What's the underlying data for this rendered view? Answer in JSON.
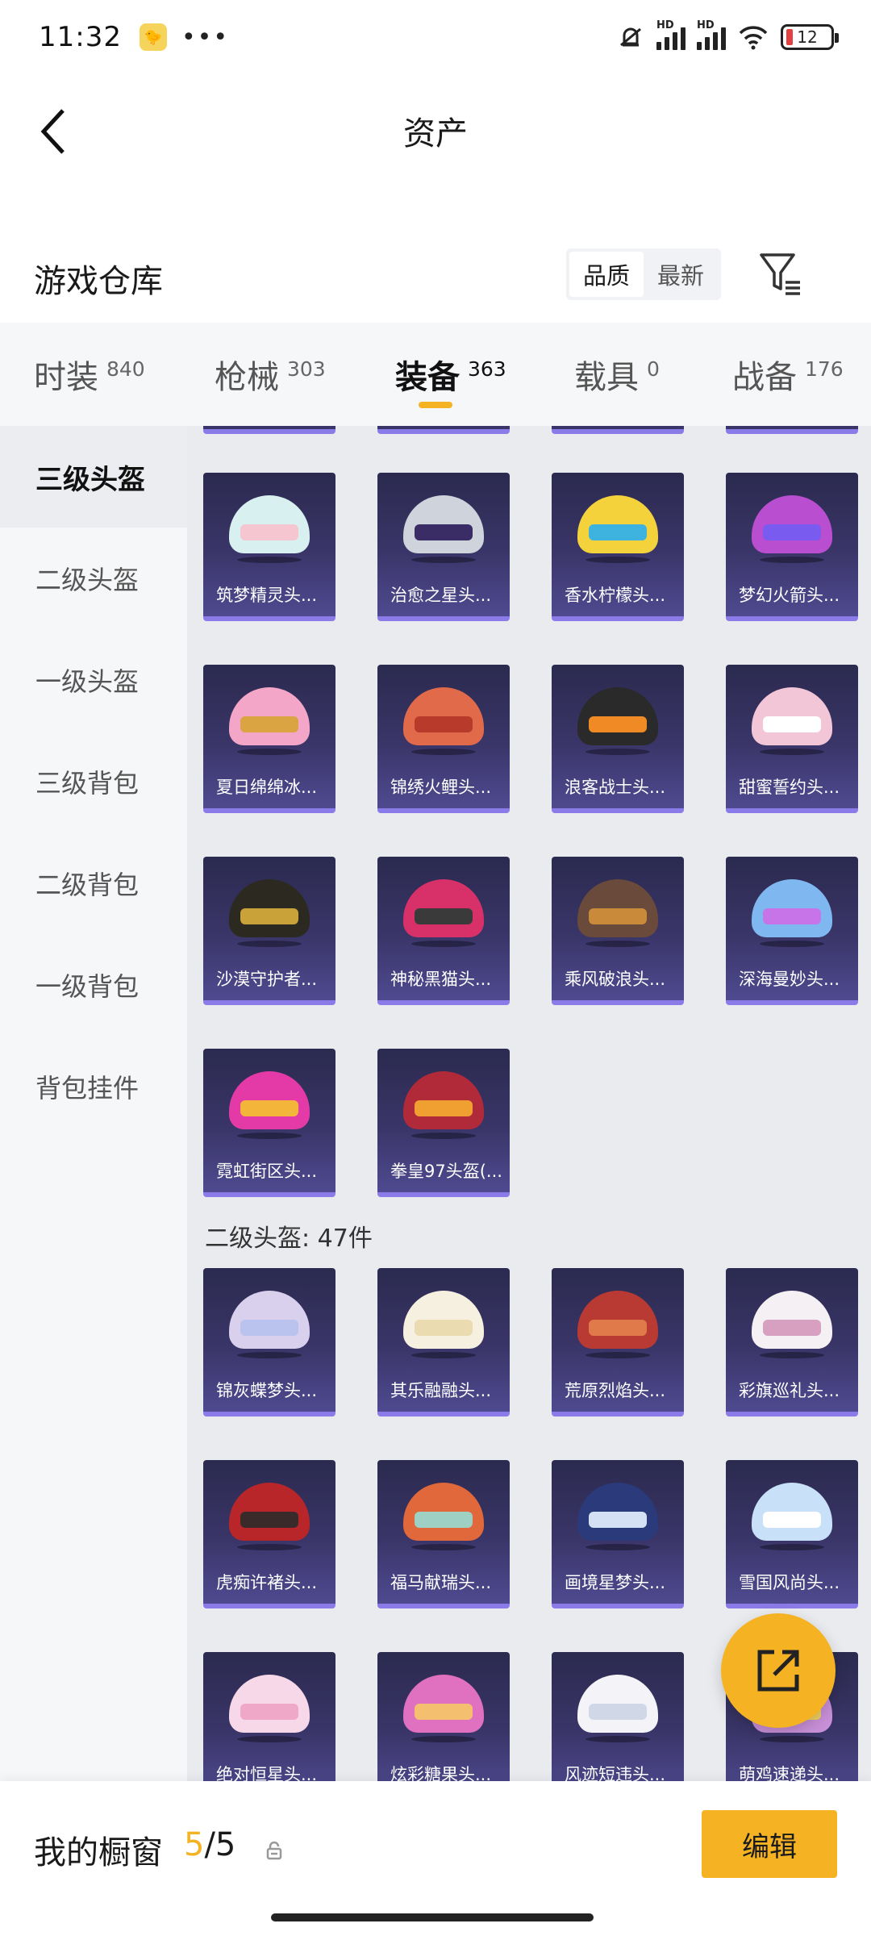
{
  "status_bar": {
    "time": "11:32",
    "dots": "•••",
    "battery": "12",
    "signal_label": "HD",
    "colors": {
      "battery_low": "#e34141"
    }
  },
  "header": {
    "title": "资产",
    "back_icon": "chevron-left-icon"
  },
  "warehouse": {
    "title": "游戏仓库",
    "sort_options": [
      "品质",
      "最新"
    ],
    "sort_selected": "品质",
    "filter_icon": "filter-icon"
  },
  "tabs": [
    {
      "label": "时装",
      "count": "840"
    },
    {
      "label": "枪械",
      "count": "303"
    },
    {
      "label": "装备",
      "count": "363",
      "active": true
    },
    {
      "label": "载具",
      "count": "0"
    },
    {
      "label": "战备",
      "count": "176"
    }
  ],
  "sidebar": {
    "items": [
      "三级头盔",
      "二级头盔",
      "一级头盔",
      "三级背包",
      "二级背包",
      "一级背包",
      "背包挂件"
    ],
    "active_index": 0
  },
  "content": {
    "level3_items": [
      "筑梦精灵头...",
      "治愈之星头...",
      "香水柠檬头...",
      "梦幻火箭头...",
      "夏日绵绵冰...",
      "锦绣火鲤头...",
      "浪客战士头...",
      "甜蜜誓约头...",
      "沙漠守护者...",
      "神秘黑猫头...",
      "乘风破浪头...",
      "深海曼妙头...",
      "霓虹街区头...",
      "拳皇97头盔(..."
    ],
    "level2_header": "二级头盔: 47件",
    "level2_items": [
      "锦灰蝶梦头...",
      "其乐融融头...",
      "荒原烈焰头...",
      "彩旗巡礼头...",
      "虎痴许褚头...",
      "福马献瑞头...",
      "画境星梦头...",
      "雪国风尚头...",
      "绝对恒星头...",
      "炫彩糖果头...",
      "风迹短违头...",
      "萌鸡速递头..."
    ]
  },
  "fab": {
    "icon": "share-external-icon"
  },
  "bottom": {
    "showcase_label": "我的橱窗",
    "showcase_current": "5",
    "showcase_total": "/5",
    "lock_icon": "lock-icon",
    "edit_label": "编辑",
    "accent": "#f5b324"
  }
}
